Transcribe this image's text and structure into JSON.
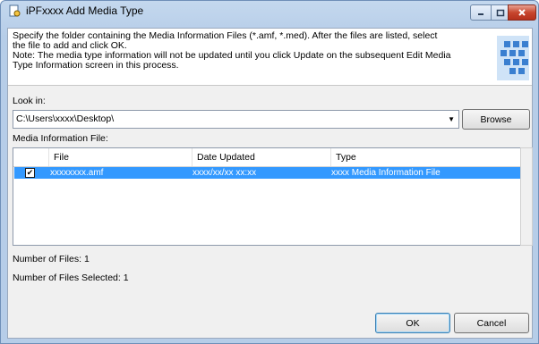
{
  "window": {
    "title": "iPFxxxx Add Media Type"
  },
  "header": {
    "instruction_1": "Specify the folder containing the Media Information Files (*.amf, *.med). After the files are listed, select the file to add and click OK.",
    "instruction_2": "Note: The media type information will not be updated until you click Update on the subsequent Edit Media Type Information screen in this process."
  },
  "look_in": {
    "label": "Look in:",
    "value": "C:\\Users\\xxxx\\Desktop\\",
    "browse_label": "Browse"
  },
  "media_list": {
    "label": "Media Information File:",
    "columns": [
      "File",
      "Date Updated",
      "Type"
    ],
    "rows": [
      {
        "checked": true,
        "file": "xxxxxxxx.amf",
        "date_updated": "xxxx/xx/xx xx:xx",
        "type": "xxxx Media Information File"
      }
    ]
  },
  "stats": {
    "number_of_files": "Number of Files: 1",
    "number_selected": "Number of Files Selected: 1"
  },
  "buttons": {
    "ok": "OK",
    "cancel": "Cancel"
  },
  "icons": {
    "app": "document-gear-icon",
    "header_graphic": "blue-cubes-icon"
  },
  "colors": {
    "selection": "#3399ff",
    "close_button": "#c7462e"
  }
}
